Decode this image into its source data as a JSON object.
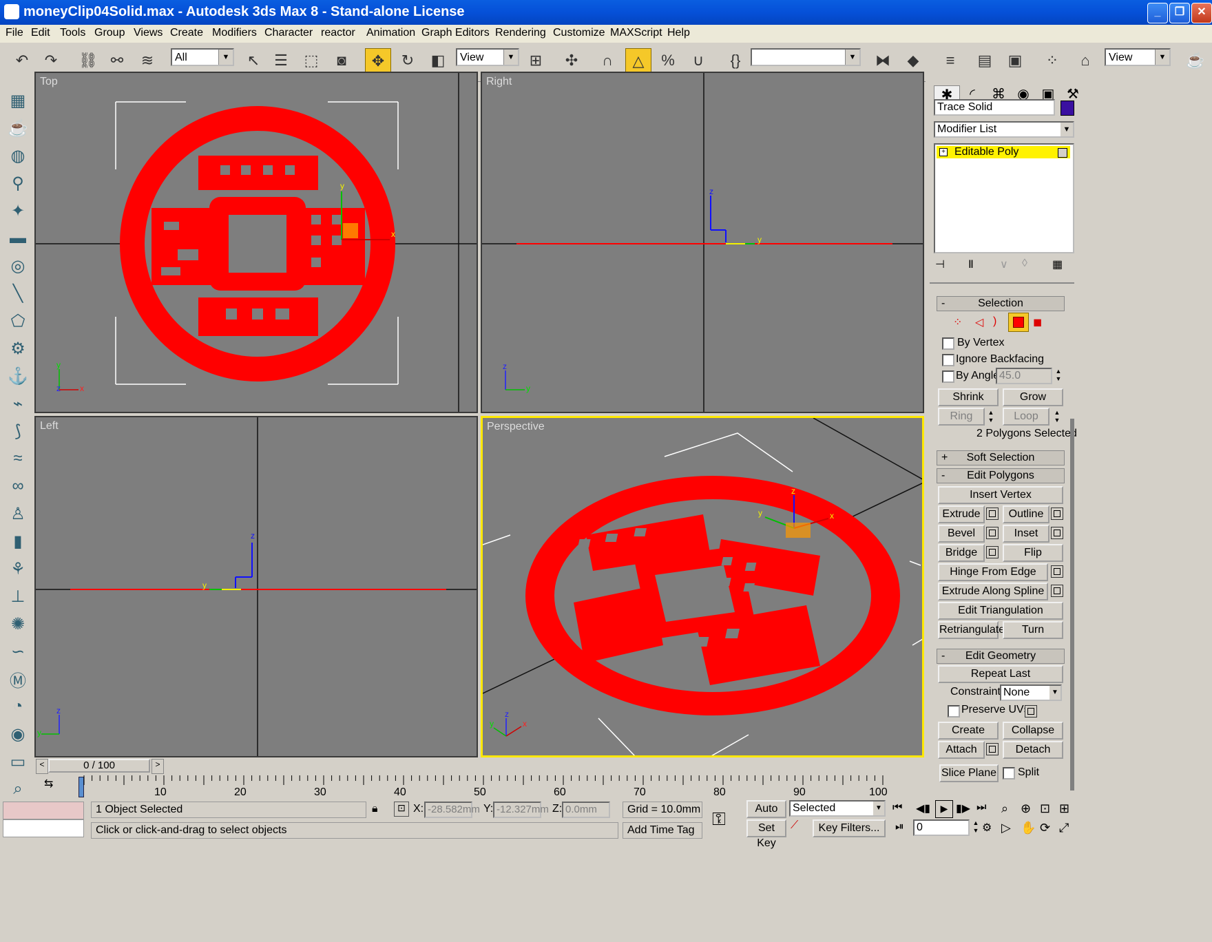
{
  "window": {
    "title": "moneyClip04Solid.max - Autodesk 3ds Max 8  - Stand-alone License",
    "app_icon": "3dsmax-icon",
    "minimize": "_",
    "maximize": "❐",
    "close": "✕"
  },
  "menubar": [
    "File",
    "Edit",
    "Tools",
    "Group",
    "Views",
    "Create",
    "Modifiers",
    "Character",
    "reactor",
    "Animation",
    "Graph Editors",
    "Rendering",
    "Customize",
    "MAXScript",
    "Help"
  ],
  "toolbar": {
    "selection_filter": "All",
    "ref_coord": "View",
    "named_selection": "",
    "view_dropdown": "View"
  },
  "viewports": {
    "top": {
      "label": "Top"
    },
    "right": {
      "label": "Right"
    },
    "left": {
      "label": "Left"
    },
    "perspective": {
      "label": "Perspective"
    }
  },
  "axes": {
    "x": "x",
    "y": "y",
    "z": "z"
  },
  "command_panel": {
    "object_name": "Trace Solid",
    "object_color": "#3a10a0",
    "modifier_list": "Modifier List",
    "stack_item": "Editable Poly",
    "selection": {
      "header": "Selection",
      "header_sign": "-",
      "by_vertex": "By Vertex",
      "ignore_backfacing": "Ignore Backfacing",
      "by_angle": "By Angle:",
      "by_angle_value": "45.0",
      "shrink": "Shrink",
      "grow": "Grow",
      "ring": "Ring",
      "loop": "Loop",
      "status": "2 Polygons Selected"
    },
    "soft_selection": {
      "header": "Soft Selection",
      "header_sign": "+"
    },
    "edit_polygons": {
      "header": "Edit Polygons",
      "header_sign": "-",
      "insert_vertex": "Insert Vertex",
      "extrude": "Extrude",
      "outline": "Outline",
      "bevel": "Bevel",
      "inset": "Inset",
      "bridge": "Bridge",
      "flip": "Flip",
      "hinge_from_edge": "Hinge From Edge",
      "extrude_along_spline": "Extrude Along Spline",
      "edit_triangulation": "Edit Triangulation",
      "retriangulate": "Retriangulate",
      "turn": "Turn"
    },
    "edit_geometry": {
      "header": "Edit Geometry",
      "header_sign": "-",
      "repeat_last": "Repeat Last",
      "constraints_label": "Constraints:",
      "constraints_value": "None",
      "preserve_uvs": "Preserve UVs",
      "create": "Create",
      "collapse": "Collapse",
      "attach": "Attach",
      "detach": "Detach",
      "slice_plane": "Slice Plane",
      "split": "Split"
    }
  },
  "time": {
    "slider": "0 / 100",
    "ticks": [
      "10",
      "20",
      "30",
      "40",
      "50",
      "60",
      "70",
      "80",
      "90",
      "100"
    ]
  },
  "status": {
    "objects_selected": "1 Object Selected",
    "prompt": "Click or click-and-drag to select objects",
    "x_label": "X:",
    "x_value": "-28.582mm",
    "y_label": "Y:",
    "y_value": "-12.327mm",
    "z_label": "Z:",
    "z_value": "0.0mm",
    "grid": "Grid = 10.0mm",
    "add_time_tag": "Add Time Tag",
    "auto_key": "Auto Key",
    "set_key": "Set Key",
    "key_mode": "Selected",
    "key_filters": "Key Filters...",
    "frame": "0"
  },
  "colors": {
    "viewport_bg": "#7e7e7e",
    "object_red": "#ff0000",
    "active_border": "#ffe800",
    "highlight": "#f5c829"
  }
}
